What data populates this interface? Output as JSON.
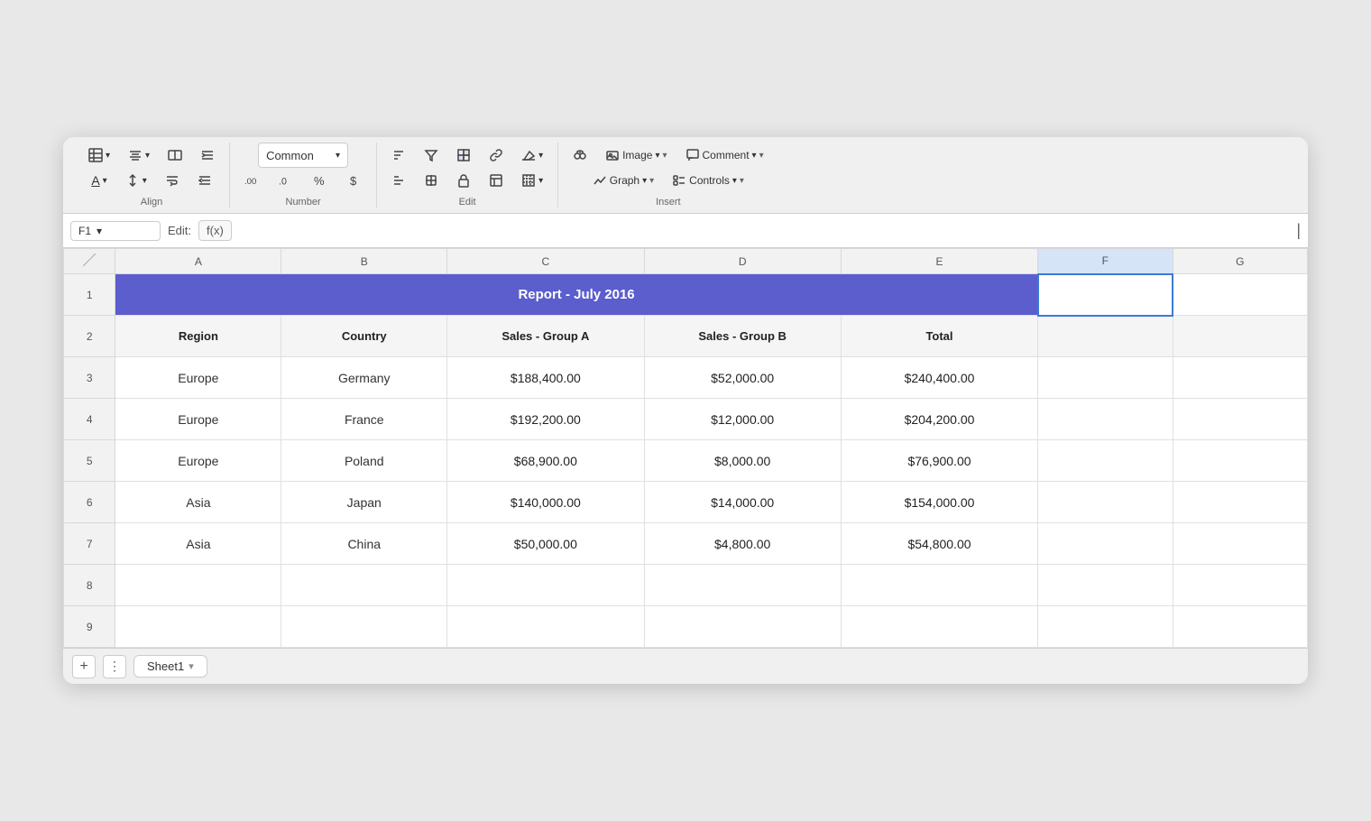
{
  "toolbar": {
    "groups": [
      {
        "label": "Align",
        "rows": [
          [
            "table-icon",
            "align-center-icon",
            "merge-icon",
            "indent-right-icon"
          ],
          [
            "font-color-icon",
            "valign-icon",
            "wrap-icon",
            "indent-left-icon"
          ]
        ]
      },
      {
        "label": "Number",
        "rows": [
          [
            "decimal-inc-icon",
            "decimal-dec-icon"
          ],
          [
            "number-format-icon2",
            "percent-icon"
          ]
        ],
        "dropdown": "Common"
      },
      {
        "label": "Edit",
        "rows": [
          [
            "sort-icon",
            "filter-icon",
            "pivot-icon",
            "link-icon",
            "eraser-icon"
          ],
          [
            "sort2-icon",
            "freeze-icon",
            "lock-icon",
            "sheet-icon",
            "border-icon"
          ]
        ]
      },
      {
        "label": "Insert",
        "rows": [
          [
            "binoculars-icon",
            "image-icon",
            "comment-icon"
          ],
          [
            "graph-icon",
            "controls-icon"
          ]
        ],
        "dropdowns": [
          "Image",
          "Comment",
          "Graph",
          "Controls"
        ]
      }
    ]
  },
  "formula_bar": {
    "cell_ref": "F1",
    "edit_label": "Edit:",
    "fx_label": "f(x)"
  },
  "columns": [
    "A",
    "B",
    "C",
    "D",
    "E",
    "F",
    "G"
  ],
  "rows": [
    {
      "num": 1,
      "type": "title",
      "cells": {
        "A": "Report - July 2016",
        "merged_cols": 5
      }
    },
    {
      "num": 2,
      "type": "header",
      "cells": [
        "Region",
        "Country",
        "Sales - Group A",
        "Sales - Group B",
        "Total"
      ]
    },
    {
      "num": 3,
      "type": "data",
      "cells": [
        "Europe",
        "Germany",
        "$188,400.00",
        "$52,000.00",
        "$240,400.00"
      ]
    },
    {
      "num": 4,
      "type": "data",
      "cells": [
        "Europe",
        "France",
        "$192,200.00",
        "$12,000.00",
        "$204,200.00"
      ]
    },
    {
      "num": 5,
      "type": "data",
      "cells": [
        "Europe",
        "Poland",
        "$68,900.00",
        "$8,000.00",
        "$76,900.00"
      ]
    },
    {
      "num": 6,
      "type": "data",
      "cells": [
        "Asia",
        "Japan",
        "$140,000.00",
        "$14,000.00",
        "$154,000.00"
      ]
    },
    {
      "num": 7,
      "type": "data",
      "cells": [
        "Asia",
        "China",
        "$50,000.00",
        "$4,800.00",
        "$54,800.00"
      ]
    },
    {
      "num": 8,
      "type": "empty"
    },
    {
      "num": 9,
      "type": "empty"
    }
  ],
  "sheets": [
    {
      "name": "Sheet1"
    }
  ],
  "title_bg": "#5b5ecc",
  "selected_cell": "F1"
}
